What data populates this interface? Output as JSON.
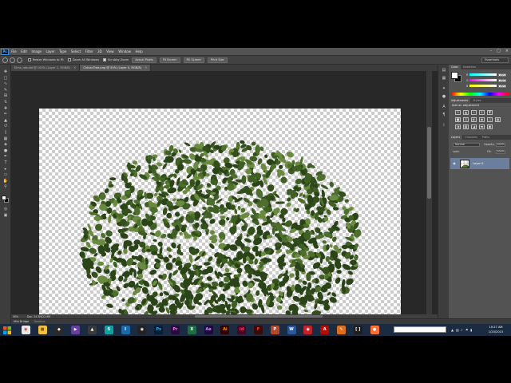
{
  "app": {
    "logo": "Ps",
    "menu": [
      "File",
      "Edit",
      "Image",
      "Layer",
      "Type",
      "Select",
      "Filter",
      "3D",
      "View",
      "Window",
      "Help"
    ]
  },
  "options": {
    "resize_windows": "Resize Windows to Fit",
    "zoom_all": "Zoom All Windows",
    "scrubby_zoom": "Scrubby Zoom",
    "actual_pixels": "Actual Pixels",
    "fit_screen": "Fit Screen",
    "fill_screen": "Fill Screen",
    "print_size": "Print Size",
    "workspace": "Essentials"
  },
  "tabs": [
    {
      "label": "Elms_rebuild @ 100% (Layer 1, RGB/8)"
    },
    {
      "label": "Chinar-Tree.png @ 50% (Layer 0, RGB/8)"
    }
  ],
  "status": {
    "zoom": "50%",
    "doc": "Doc: 24.3M/22.9M"
  },
  "bottom": {
    "mini_bridge": "Mini Bridge",
    "timeline": "Timeline"
  },
  "color_panel": {
    "tabs": [
      "Color",
      "Swatches"
    ],
    "r_label": "R",
    "g_label": "G",
    "b_label": "B",
    "r": "255",
    "g": "255",
    "b": "255",
    "foreground": "#ffffff",
    "background": "#000000"
  },
  "adjustments": {
    "tabs": [
      "Adjustments",
      "Styles"
    ],
    "title": "Add an adjustment"
  },
  "layers": {
    "tabs": [
      "Layers",
      "Channels",
      "Paths"
    ],
    "blend": "Normal",
    "opacity_label": "Opacity:",
    "opacity": "100%",
    "lock_label": "Lock:",
    "fill_label": "Fill:",
    "fill": "100%",
    "layer_name": "Layer 0"
  },
  "clock": {
    "time": "10:27 AM",
    "date": "1/20/2015"
  },
  "icons": {
    "tools": [
      "move-tool-icon",
      "marquee-tool-icon",
      "lasso-tool-icon",
      "quick-select-tool-icon",
      "crop-tool-icon",
      "eyedropper-tool-icon",
      "healing-brush-icon",
      "brush-tool-icon",
      "clone-stamp-icon",
      "history-brush-icon",
      "eraser-tool-icon",
      "gradient-tool-icon",
      "blur-tool-icon",
      "dodge-tool-icon",
      "pen-tool-icon",
      "type-tool-icon",
      "path-select-icon",
      "shape-tool-icon",
      "hand-tool-icon",
      "zoom-tool-icon"
    ],
    "taskbar": [
      "start-icon",
      "chrome-icon",
      "explorer-icon",
      "unity-icon",
      "visual-studio-icon",
      "unity-flat-icon",
      "maya-icon",
      "3dsmax-icon",
      "unity-dark-icon",
      "photoshop-icon",
      "premiere-icon",
      "excel-icon",
      "aftereffects-icon",
      "illustrator-icon",
      "indesign-icon",
      "flash-icon",
      "powerpoint-icon",
      "word-icon",
      "sketchup-icon",
      "acrobat-icon",
      "paint-icon",
      "brackets-icon",
      "firefox-icon"
    ]
  },
  "colors": {
    "panel": "#535353",
    "canvas_bg": "#282828",
    "taskbar": "#1b2c42",
    "leaf_dark": "#2a4418",
    "leaf_mid": "#3f5f25",
    "leaf_light": "#6a8a40"
  }
}
